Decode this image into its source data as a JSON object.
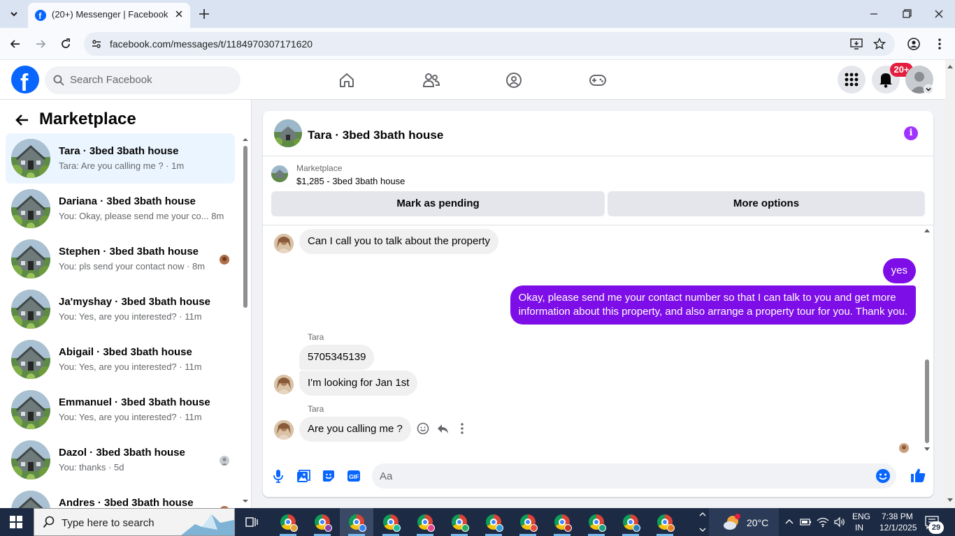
{
  "browser": {
    "tab_title": "(20+) Messenger | Facebook",
    "url": "facebook.com/messages/t/1184970307171620"
  },
  "fb_header": {
    "search_placeholder": "Search Facebook",
    "notifications_badge": "20+"
  },
  "sidebar": {
    "title": "Marketplace",
    "conversations": [
      {
        "name": "Tara · 3bed 3bath house",
        "snippet": "Tara: Are you calling me ? · 1m",
        "active": true
      },
      {
        "name": "Dariana · 3bed 3bath house",
        "snippet": "You: Okay, please send me your co...  8m",
        "active": false
      },
      {
        "name": "Stephen · 3bed 3bath house",
        "snippet": "You: pls send your contact now · 8m",
        "active": false
      },
      {
        "name": "Ja'myshay · 3bed 3bath house",
        "snippet": "You: Yes, are you interested? · 11m",
        "active": false
      },
      {
        "name": "Abigail · 3bed 3bath house",
        "snippet": "You: Yes, are you interested? · 11m",
        "active": false
      },
      {
        "name": "Emmanuel · 3bed 3bath house",
        "snippet": "You: Yes, are you interested? · 11m",
        "active": false
      },
      {
        "name": "Dazol · 3bed 3bath house",
        "snippet": "You: thanks · 5d",
        "active": false
      },
      {
        "name": "Andres · 3bed 3bath house",
        "snippet": "",
        "active": false
      }
    ]
  },
  "chat": {
    "title": "Tara · 3bed 3bath house",
    "listing_source": "Marketplace",
    "listing_title": "$1,285 - 3bed 3bath house",
    "mark_pending_label": "Mark as pending",
    "more_options_label": "More options",
    "messages": [
      {
        "from": "Tara",
        "text": "Can I call you to talk about the property"
      },
      {
        "from": "You",
        "text": "yes"
      },
      {
        "from": "You",
        "text": "Okay, please send me your contact number so that I can talk to you and get more",
        "text2": "information about this property, and also arrange a property tour for you. Thank you."
      },
      {
        "from": "Tara",
        "sender_label": "Tara",
        "text": "5705345139"
      },
      {
        "from": "Tara",
        "text": "I'm looking for Jan 1st"
      },
      {
        "from": "Tara",
        "sender_label": "Tara",
        "text": "Are you calling me ?"
      }
    ],
    "composer_placeholder": "Aa"
  },
  "taskbar": {
    "search_placeholder": "Type here to search",
    "weather": "20°C",
    "language": "ENG",
    "region": "IN",
    "time": "7:38 PM",
    "date": "12/1/2025",
    "notification_count": "29"
  },
  "colors": {
    "facebook_blue": "#0866ff",
    "outgoing_bubble": "#7e0ee8",
    "active_conv_bg": "#ebf5ff",
    "badge_red": "#e41e3f"
  }
}
